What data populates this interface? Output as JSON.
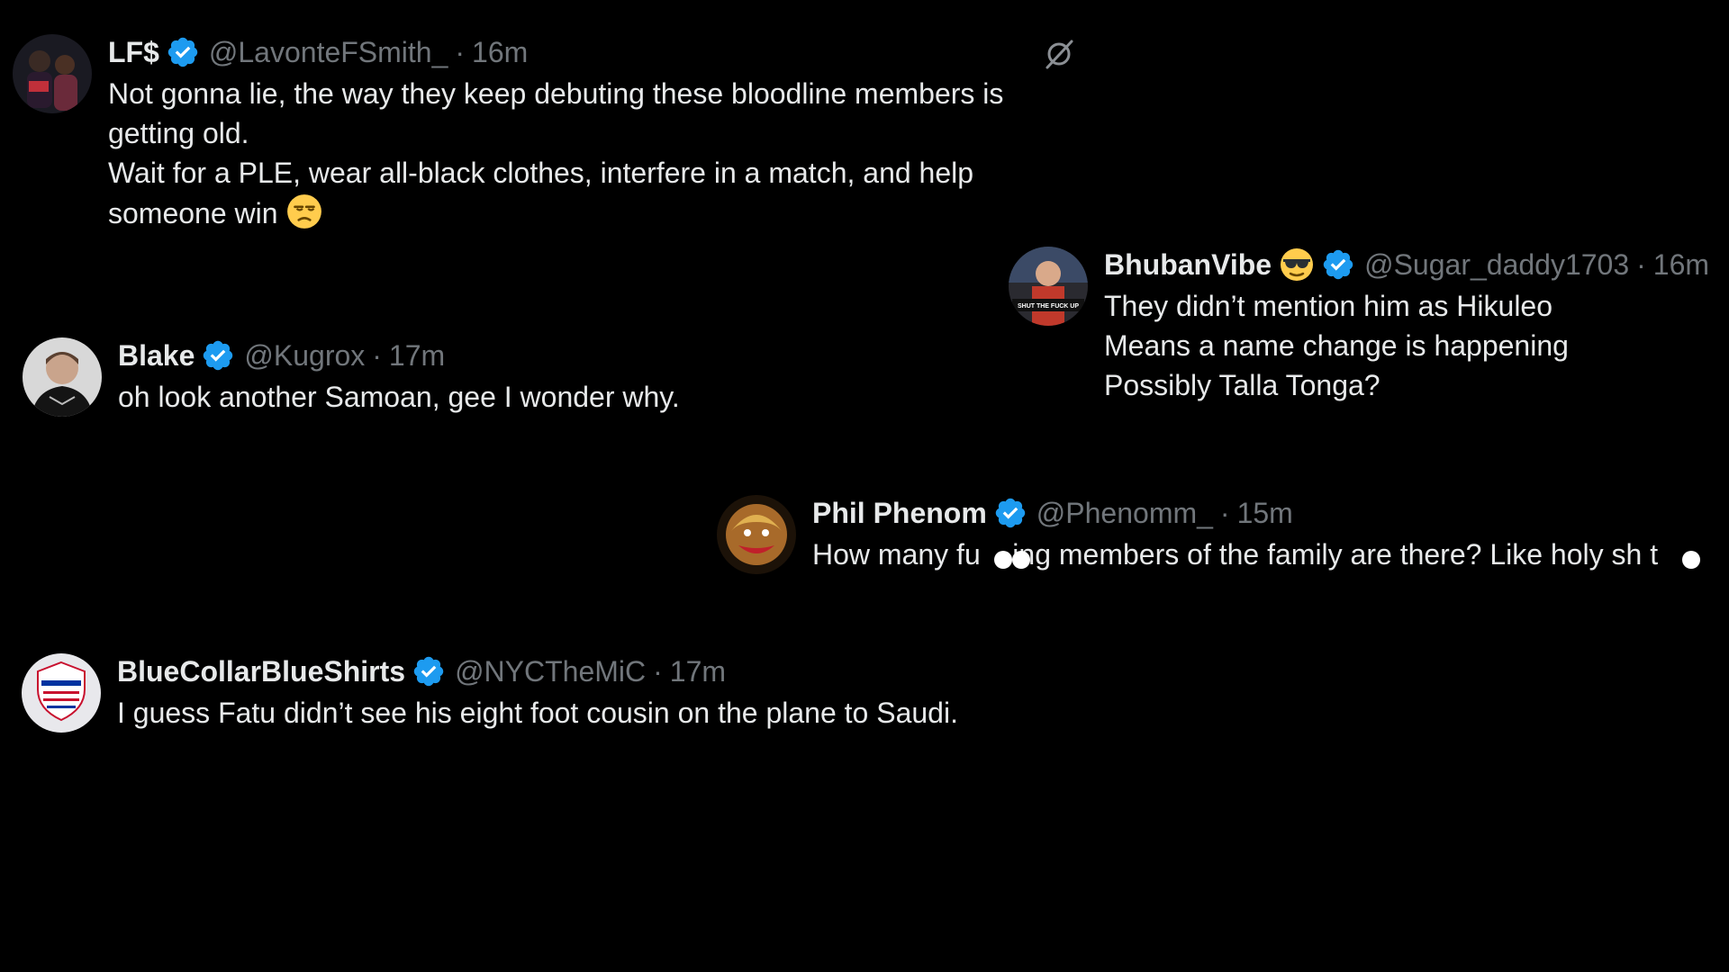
{
  "colors": {
    "background": "#000000",
    "text": "#e7e9ea",
    "muted": "#71767b",
    "verified": "#1d9bf0"
  },
  "icons": {
    "verified": "verified-badge-icon",
    "mute": "mute-slash-icon",
    "unamused": "unamused-face-emoji",
    "sunglasses": "sunglasses-face-emoji"
  },
  "tweets": [
    {
      "name": "LF$",
      "handle": "@LavonteFSmith_",
      "time": "16m",
      "lines": [
        "Not gonna lie, the way they keep debuting these bloodline members is",
        "getting old.",
        "Wait for a PLE, wear all-black clothes, interfere in a match, and help",
        "someone win"
      ]
    },
    {
      "name": "BhubanVibe",
      "handle": "@Sugar_daddy1703",
      "time": "16m",
      "lines": [
        "They didn’t mention him as Hikuleo",
        "Means a name change is happening",
        "Possibly Talla Tonga?"
      ]
    },
    {
      "name": "Blake",
      "handle": "@Kugrox",
      "time": "17m",
      "lines": [
        "oh look another Samoan, gee I wonder why."
      ]
    },
    {
      "name": "Phil Phenom",
      "handle": "@Phenomm_",
      "time": "15m",
      "lines": [
        "How many fu    ing members of the family are there? Like holy sh t"
      ]
    },
    {
      "name": "BlueCollarBlueShirts",
      "handle": "@NYCTheMiC",
      "time": "17m",
      "lines": [
        "I guess Fatu didn’t see his eight foot cousin on the plane to Saudi."
      ]
    }
  ],
  "separator": "·",
  "avatar_text": {
    "bhuban": "SHUT THE FUCK UP"
  }
}
